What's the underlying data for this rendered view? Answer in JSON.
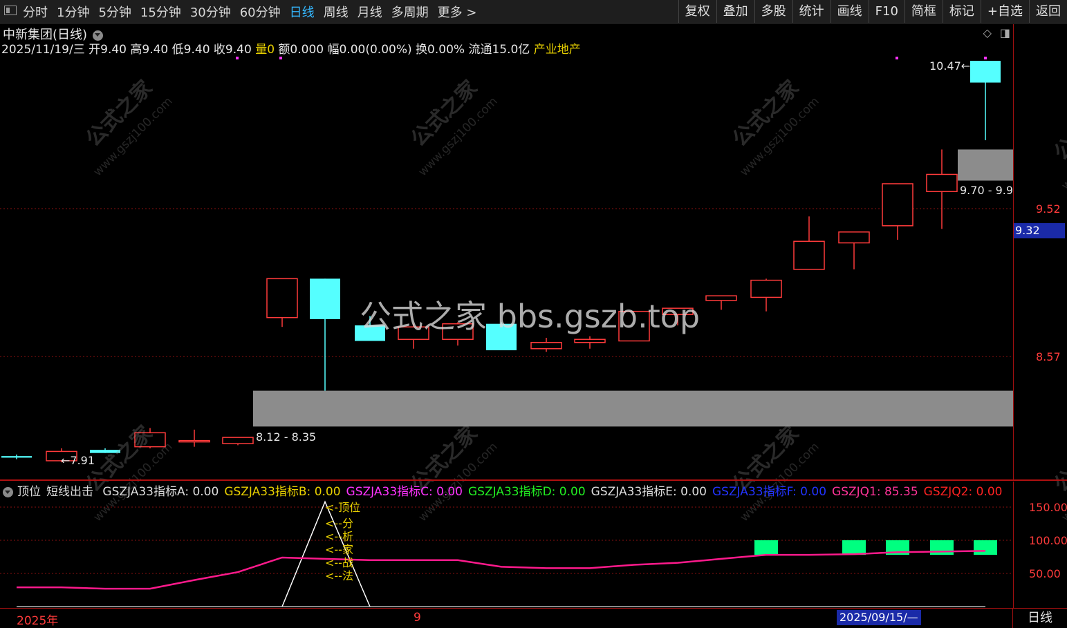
{
  "toolbar": {
    "periods": [
      "分时",
      "1分钟",
      "5分钟",
      "15分钟",
      "30分钟",
      "60分钟",
      "日线",
      "周线",
      "月线",
      "多周期",
      "更多 >"
    ],
    "active_period": "日线",
    "tools": [
      "复权",
      "叠加",
      "多股",
      "统计",
      "画线",
      "F10",
      "简框",
      "标记",
      "+自选",
      "返回"
    ]
  },
  "stock": {
    "title": "中新集团(日线)",
    "date": "2025/11/19/三",
    "open_label": "开",
    "open": "9.40",
    "high_label": "高",
    "high": "9.40",
    "low_label": "低",
    "low": "9.40",
    "close_label": "收",
    "close": "9.40",
    "volume_label": "量",
    "volume": "0",
    "amount_label": "额",
    "amount": "0.000",
    "change_label": "幅",
    "change": "0.00(0.00%)",
    "turnover_label": "换",
    "turnover": "0.00%",
    "float_label": "流通",
    "float": "15.0亿",
    "sector": "产业地产"
  },
  "price_axis": {
    "ticks": [
      "9.52",
      "8.57"
    ],
    "current_price": "9.32"
  },
  "annotations": {
    "high_marker": "10.47",
    "low_marker": "←7.91",
    "zone_low_label": "8.12 - 8.35",
    "zone_high_label": "9.70 - 9.9"
  },
  "watermark": {
    "main": "公式之家 bbs.gszb.top",
    "tile_text": "公式之家",
    "tile_url": "www.gszj100.com"
  },
  "indicator": {
    "name": "顶位",
    "signal": "短线出击",
    "fields": [
      {
        "label": "GSZJA33指标A: 0.00",
        "color": "#dddddd"
      },
      {
        "label": "GSZJA33指标B: 0.00",
        "color": "#e8d000"
      },
      {
        "label": "GSZJA33指标C: 0.00",
        "color": "#ff33ff"
      },
      {
        "label": "GSZJA33指标D: 0.00",
        "color": "#22ee22"
      },
      {
        "label": "GSZJA33指标E: 0.00",
        "color": "#dddddd"
      },
      {
        "label": "GSZJA33指标F: 0.00",
        "color": "#2233ff"
      },
      {
        "label": "GSZJQ1: 85.35",
        "color": "#ff3399"
      },
      {
        "label": "GSZJQ2: 0.00",
        "color": "#ff2222"
      }
    ],
    "axis_ticks": [
      "150.00",
      "100.00",
      "50.00"
    ],
    "peak_labels": [
      "<-顶位",
      "<--分",
      "<--析",
      "<--家",
      "<--战",
      "<--法"
    ]
  },
  "bottom": {
    "year_label": "2025年",
    "month_label": "9",
    "cursor_date": "2025/09/15/—",
    "period": "日线"
  },
  "colors": {
    "up": "#ff3b3b",
    "down": "#55ffff",
    "zone": "#8c8c8c",
    "line_q1": "#ff1a8c",
    "signal_box": "#00ff80"
  }
}
